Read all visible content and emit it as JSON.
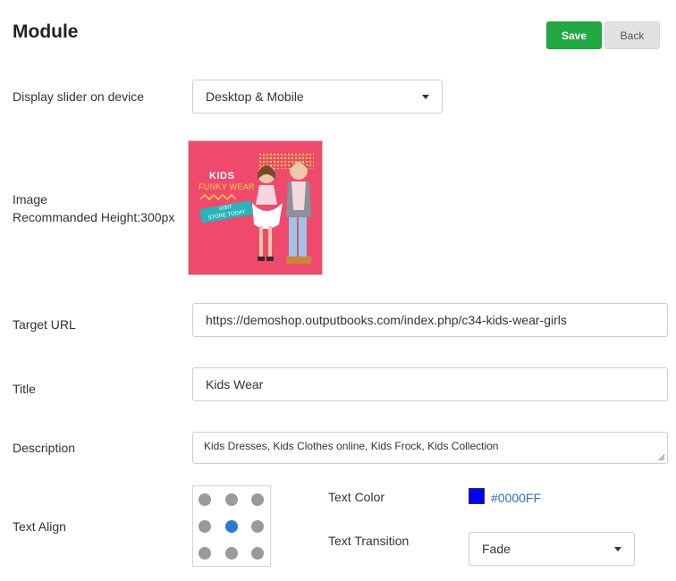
{
  "header": {
    "title": "Module",
    "save_label": "Save",
    "back_label": "Back"
  },
  "fields": {
    "device": {
      "label": "Display slider on device",
      "value": "Desktop & Mobile"
    },
    "image": {
      "label_line1": "Image",
      "label_line2": "Recommanded Height:300px",
      "banner_kids": "KIDS",
      "banner_funky": "FUNKY WEAR",
      "banner_visit": "VISIT",
      "banner_store": "STORE TODAY"
    },
    "target_url": {
      "label": "Target URL",
      "value": "https://demoshop.outputbooks.com/index.php/c34-kids-wear-girls"
    },
    "title": {
      "label": "Title",
      "value": "Kids Wear"
    },
    "description": {
      "label": "Description",
      "value": "Kids Dresses, Kids Clothes online, Kids Frock, Kids Collection"
    },
    "text_align": {
      "label": "Text Align",
      "selected_index": 4
    },
    "text_color": {
      "label": "Text Color",
      "value": "#0000FF"
    },
    "text_transition": {
      "label": "Text Transition",
      "value": "Fade"
    }
  },
  "colors": {
    "save_bg": "#22a943",
    "back_bg": "#e2e2e2",
    "accent_link": "#2f6fb3",
    "active_dot": "#2a7ad2",
    "banner_bg": "#ef4a6d"
  }
}
